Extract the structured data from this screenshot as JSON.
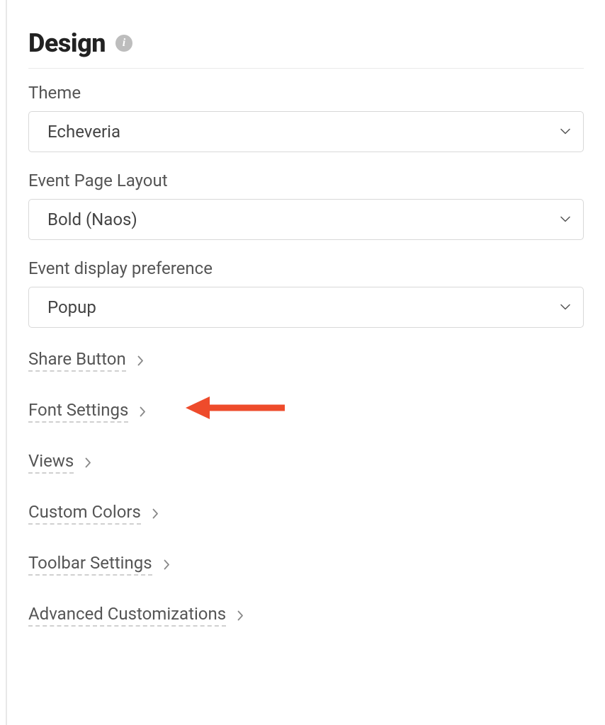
{
  "section": {
    "title": "Design"
  },
  "fields": {
    "theme": {
      "label": "Theme",
      "value": "Echeveria"
    },
    "eventPageLayout": {
      "label": "Event Page Layout",
      "value": "Bold (Naos)"
    },
    "eventDisplayPreference": {
      "label": "Event display preference",
      "value": "Popup"
    }
  },
  "collapsibles": {
    "shareButton": "Share Button",
    "fontSettings": "Font Settings",
    "views": "Views",
    "customColors": "Custom Colors",
    "toolbarSettings": "Toolbar Settings",
    "advancedCustomizations": "Advanced Customizations"
  },
  "icons": {
    "info": "i"
  }
}
